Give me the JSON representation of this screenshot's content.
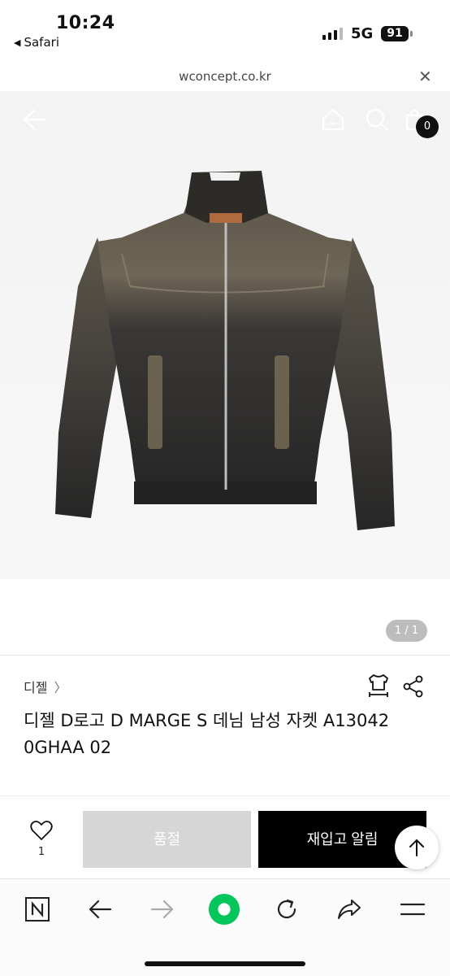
{
  "status": {
    "time": "10:24",
    "back_app": "Safari",
    "network": "5G",
    "battery": "91"
  },
  "browser": {
    "url": "wconcept.co.kr"
  },
  "header": {
    "cart_count": "0"
  },
  "gallery": {
    "counter": "1 / 1"
  },
  "product": {
    "brand": "디젤",
    "title": "디젤 D로고 D MARGE S 데님 남성 자켓 A13042 0GHAA 02"
  },
  "actions": {
    "like_count": "1",
    "soldout_label": "품절",
    "restock_label": "재입고 알림"
  },
  "colors": {
    "accent_green": "#03c75a",
    "badge_bg": "#111111"
  }
}
